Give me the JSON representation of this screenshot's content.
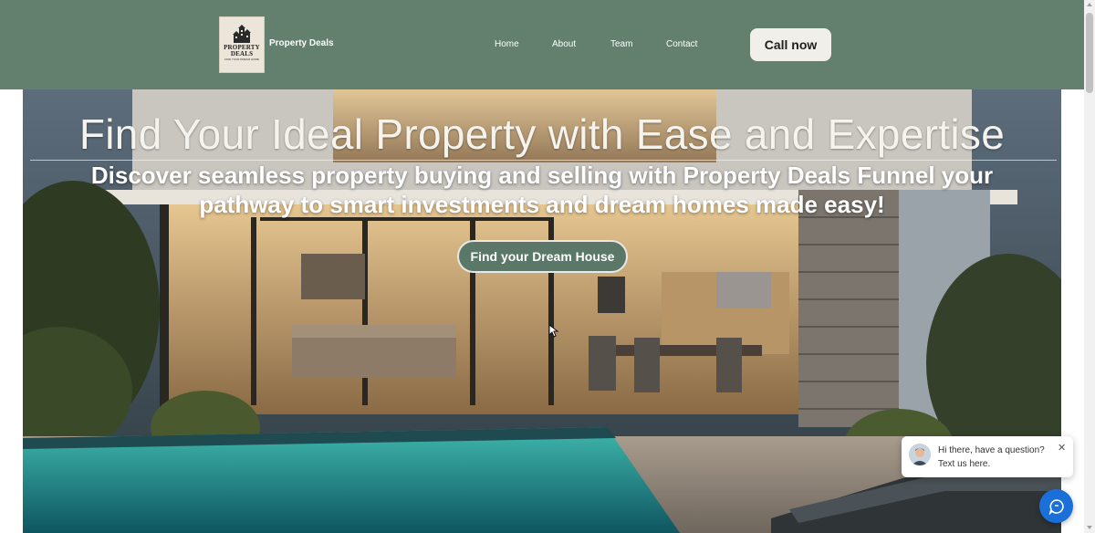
{
  "header": {
    "brand_name": "Property Deals",
    "logo": {
      "line1": "PROPERTY",
      "line2": "DEALS",
      "tagline": "FIND YOUR DREAM HOME"
    },
    "nav": [
      {
        "label": "Home"
      },
      {
        "label": "About"
      },
      {
        "label": "Team"
      },
      {
        "label": "Contact"
      }
    ],
    "call_button": "Call now",
    "colors": {
      "header_bg": "#62806d",
      "button_bg": "#f1efe9"
    }
  },
  "hero": {
    "title": "Find Your Ideal Property with Ease and Expertise",
    "subtitle": "Discover seamless property buying and selling with Property Deals Funnel your pathway to smart investments and dream homes made easy!",
    "cta": "Find your Dream House",
    "background": "modern-house-with-pool-photo",
    "colors": {
      "cta_bg": "#5a7767"
    }
  },
  "chat": {
    "greeting_line1": "Hi there, have a question?",
    "greeting_line2": "Text us here.",
    "close_icon": "close-icon",
    "launcher_icon": "chat-icon",
    "colors": {
      "launcher": "#1a6fd8"
    }
  }
}
